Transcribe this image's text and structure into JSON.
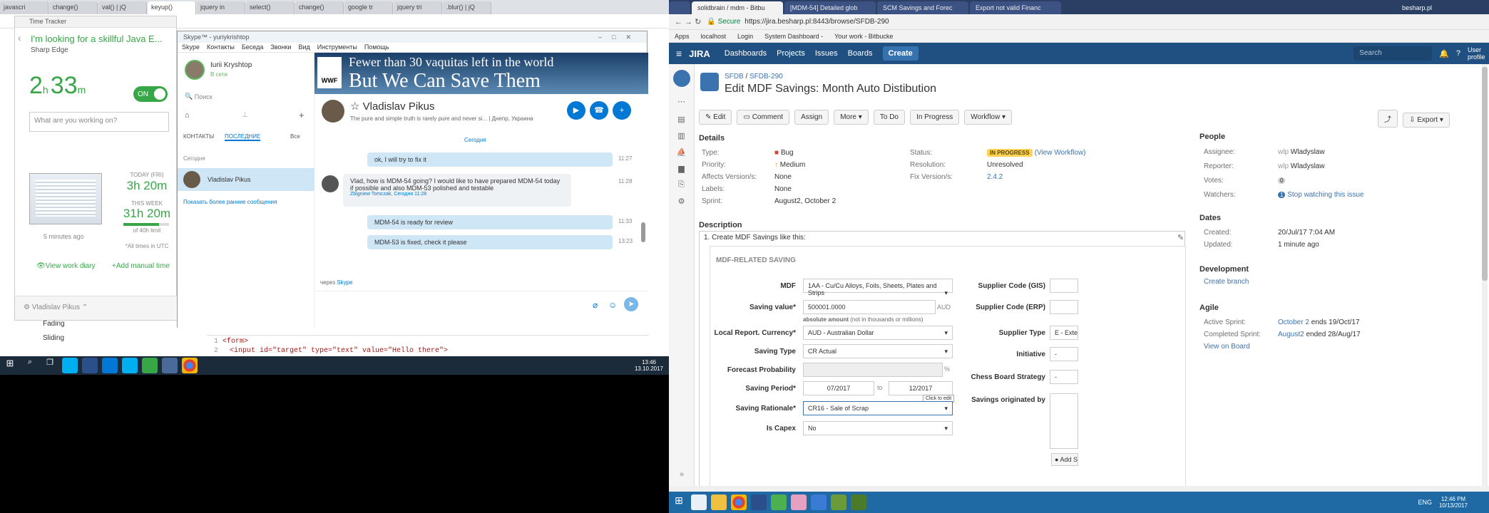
{
  "left_browser": {
    "tabs": [
      "javascri",
      "change()",
      "val() | jQ",
      "keyup()",
      "jquery in",
      "select()",
      "change()",
      "google tr",
      "jquery tri",
      ".blur() | jQ"
    ]
  },
  "time_tracker": {
    "title": "Time Tracker",
    "project": "I'm looking for a skillful Java E...",
    "client": "Sharp Edge",
    "timer_h": "2",
    "timer_h_unit": "h",
    "timer_m": "33",
    "timer_m_unit": "m",
    "toggle": "ON",
    "placeholder": "What are you working on?",
    "screenshot_ago": "5 minutes ago",
    "today_label": "TODAY (FRI)",
    "today_value": "3h 20m",
    "week_label": "THIS WEEK",
    "week_value": "31h 20m",
    "week_limit": "of 40h limit",
    "week_fraction": 0.78,
    "utc_note": "*All times in UTC",
    "view_diary": "View work diary",
    "add_manual": "Add manual time",
    "user": "Vladislav Pikus",
    "list_items": [
      "Fading",
      "Sliding"
    ]
  },
  "skype": {
    "title": "Skype™ - yuriykrishtop",
    "menu": [
      "Skype",
      "Контакты",
      "Беседа",
      "Звонки",
      "Вид",
      "Инструменты",
      "Помощь"
    ],
    "user_name": "Iurii Kryshtop",
    "user_status": "В сети",
    "search_placeholder": "Поиск",
    "tab_contacts": "КОНТАКТЫ",
    "tab_recent": "ПОСЛЕДНИЕ",
    "filter": "Все",
    "today_header": "Сегодня",
    "contact": "Vladislav Pikus",
    "older_link": "Показать более ранние сообщения",
    "banner_line1": "Fewer than 30 vaquitas left in the world",
    "banner_line2": "But We Can Save Them",
    "banner_logo": "WWF",
    "chat_name": "Vladislav Pikus",
    "chat_status": "The pure and simple truth is rarely pure and never si...",
    "chat_location": "Днепр, Украина",
    "date_sep": "Сегодня",
    "messages": [
      {
        "text": "ok, I will try to fix it",
        "time": "11:27"
      },
      {
        "text": "Vlad, how is MDM-54 going? I would like to have prepared MDM-54 today if possible and also MDM-53 polished and testable",
        "quote": "Zbigniew Tomczak, Сегодня 11:28",
        "time": "11:28"
      },
      {
        "text": "MDM-54 is ready for review",
        "time": "11:33"
      },
      {
        "text": "MDM-53 is fixed, check it please",
        "time": "13:23"
      }
    ],
    "via": "через",
    "via_link": "Skype"
  },
  "code": {
    "line1_no": "1",
    "line1": "<form>",
    "line2_no": "2",
    "line2": "<input id=\"target\" type=\"text\" value=\"Hello there\">"
  },
  "taskbar_left": {
    "time": "13:46",
    "date": "13.10.2017"
  },
  "right_browser": {
    "tabs": [
      "",
      "solidbrain / mdm - Bitbu",
      "[MDM-54] Detailed glob",
      "SCM Savings and Forec",
      "Export not valid Financ"
    ],
    "window_user": "besharp.pl",
    "secure": "Secure",
    "url": "https://jira.besharp.pl:8443/browse/SFDB-290",
    "bookmarks": [
      "Apps",
      "localhost",
      "Login",
      "System Dashboard -",
      "Your work - Bitbucke"
    ]
  },
  "jira": {
    "logo": "JIRA",
    "nav": [
      "Dashboards",
      "Projects",
      "Issues",
      "Boards"
    ],
    "create": "Create",
    "search_placeholder": "Search",
    "user_profile": "User profile",
    "breadcrumb_project": "SFDB",
    "breadcrumb_issue": "SFDB-290",
    "title": "Edit MDF Savings: Month Auto Distibution",
    "buttons": [
      "Edit",
      "Comment",
      "Assign",
      "More",
      "To Do",
      "In Progress",
      "Workflow"
    ],
    "export": "Export",
    "details_header": "Details",
    "type_label": "Type:",
    "type_value": "Bug",
    "priority_label": "Priority:",
    "priority_value": "Medium",
    "affects_label": "Affects Version/s:",
    "affects_value": "None",
    "labels_label": "Labels:",
    "labels_value": "None",
    "sprint_label": "Sprint:",
    "sprint_value": "August2, October 2",
    "status_label": "Status:",
    "status_value": "IN PROGRESS",
    "status_link": "(View Workflow)",
    "resolution_label": "Resolution:",
    "resolution_value": "Unresolved",
    "fix_label": "Fix Version/s:",
    "fix_value": "2.4.2",
    "people_header": "People",
    "assignee_label": "Assignee:",
    "assignee_value": "Wladyslaw",
    "reporter_label": "Reporter:",
    "reporter_value": "Wladyslaw",
    "votes_label": "Votes:",
    "votes_value": "0",
    "watchers_label": "Watchers:",
    "watchers_count": "1",
    "watchers_link": "Stop watching this issue",
    "dates_header": "Dates",
    "created_label": "Created:",
    "created_value": "20/Jul/17 7:04 AM",
    "updated_label": "Updated:",
    "updated_value": "1 minute ago",
    "dev_header": "Development",
    "dev_link": "Create branch",
    "agile_header": "Agile",
    "active_sprint_label": "Active Sprint:",
    "active_sprint_link": "October 2",
    "active_sprint_rest": "ends 19/Oct/17",
    "completed_label": "Completed Sprint:",
    "completed_link": "August2",
    "completed_rest": "ended 28/Aug/17",
    "view_board": "View on Board",
    "description_header": "Description",
    "desc_item": "1. Create MDF Savings like this:",
    "form_section": "MDF-RELATED SAVING",
    "form": {
      "mdf_label": "MDF",
      "mdf_value": "1AA - Cu/Cu Alloys, Foils, Sheets, Plates and Strips",
      "saving_label": "Saving value*",
      "saving_value": "500001.0000",
      "saving_unit": "AUD",
      "saving_hint_bold": "absolute amount",
      "saving_hint": "(not in thousands or millions)",
      "currency_label": "Local Report. Currency*",
      "currency_value": "AUD - Australian Dollar",
      "type_label": "Saving Type",
      "type_value": "CR Actual",
      "forecast_label": "Forecast Probability",
      "forecast_unit": "%",
      "period_label": "Saving Period*",
      "period_from": "07/2017",
      "period_to_word": "to",
      "period_to": "12/2017",
      "rationale_label": "Saving Rationale*",
      "rationale_value": "CR16 - Sale of Scrap",
      "capex_label": "Is Capex",
      "capex_value": "No",
      "gis_label": "Supplier Code (GIS)",
      "erp_label": "Supplier Code (ERP)",
      "stype_label": "Supplier Type",
      "stype_value": "E - Exte",
      "initiative_label": "Initiative",
      "initiative_value": "-",
      "chess_label": "Chess Board Strategy",
      "chess_value": "-",
      "originated_label": "Savings originated by",
      "add_btn": "Add S",
      "tooltip": "Click to edit"
    }
  },
  "taskbar_right": {
    "lang": "ENG",
    "time": "12:46 PM",
    "date": "10/13/2017"
  }
}
